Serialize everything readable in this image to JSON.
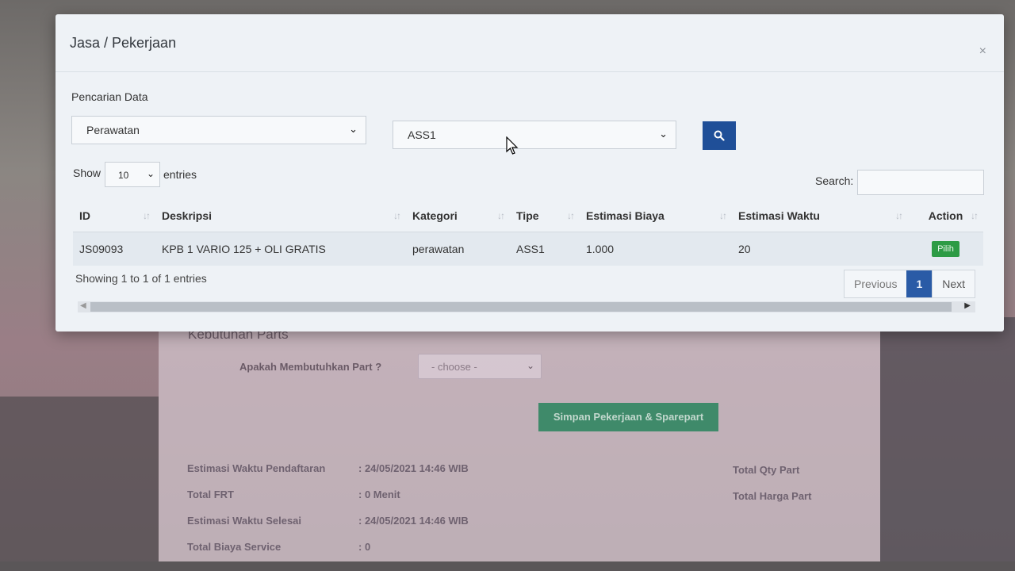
{
  "background": {
    "section_title": "Kebutuhan Parts",
    "need_part_label": "Apakah Membutuhkan Part ?",
    "need_part_select": "- choose -",
    "save_button": "Simpan Pekerjaan & Sparepart",
    "info": [
      {
        "label": "Estimasi Waktu Pendaftaran",
        "value": ": 24/05/2021 14:46 WIB"
      },
      {
        "label": "Total FRT",
        "value": ": 0 Menit"
      },
      {
        "label": "Estimasi Waktu Selesai",
        "value": ": 24/05/2021 14:46 WIB"
      },
      {
        "label": "Total Biaya Service",
        "value": ": 0"
      }
    ],
    "right_info": [
      "Total Qty Part",
      "Total Harga Part"
    ]
  },
  "modal": {
    "title": "Jasa / Pekerjaan",
    "close": "×",
    "filter_label": "Pencarian Data",
    "category_select": "Perawatan",
    "type_select": "ASS1",
    "show_label": "Show",
    "entries_label": "entries",
    "page_length": "10",
    "search_label": "Search:",
    "columns": [
      "ID",
      "Deskripsi",
      "Kategori",
      "Tipe",
      "Estimasi Biaya",
      "Estimasi Waktu",
      "Action"
    ],
    "rows": [
      {
        "id": "JS09093",
        "deskripsi": "KPB 1 VARIO 125 + OLI GRATIS",
        "kategori": "perawatan",
        "tipe": "ASS1",
        "biaya": "1.000",
        "waktu": "20",
        "action": "Pilih"
      }
    ],
    "info": "Showing 1 to 1 of 1 entries",
    "pager": {
      "previous": "Previous",
      "current": "1",
      "next": "Next"
    }
  },
  "colors": {
    "primary": "#1f4f98",
    "success": "#2d9b45",
    "pager_active": "#2a5ba6"
  }
}
